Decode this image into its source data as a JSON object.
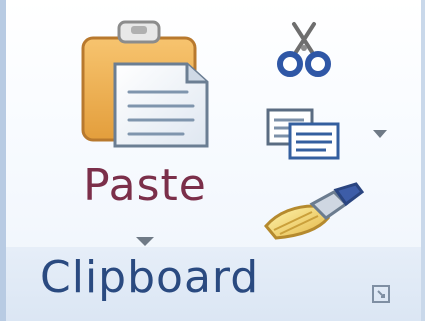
{
  "ribbon": {
    "group": {
      "title": "Clipboard",
      "paste": {
        "label": "Paste",
        "icon": "clipboard-paste-icon"
      },
      "cut": {
        "icon": "scissors-icon"
      },
      "copy": {
        "icon": "copy-icon"
      },
      "format_painter": {
        "icon": "format-painter-icon"
      },
      "dialog_launcher": {
        "icon": "dialog-launcher-icon"
      }
    }
  },
  "colors": {
    "group_border": "#b8cbe3",
    "paste_label": "#7b2f4a",
    "group_title": "#2a4a80",
    "clipboard_orange": "#f2b15b",
    "paper_blue": "#3e6ea8"
  }
}
